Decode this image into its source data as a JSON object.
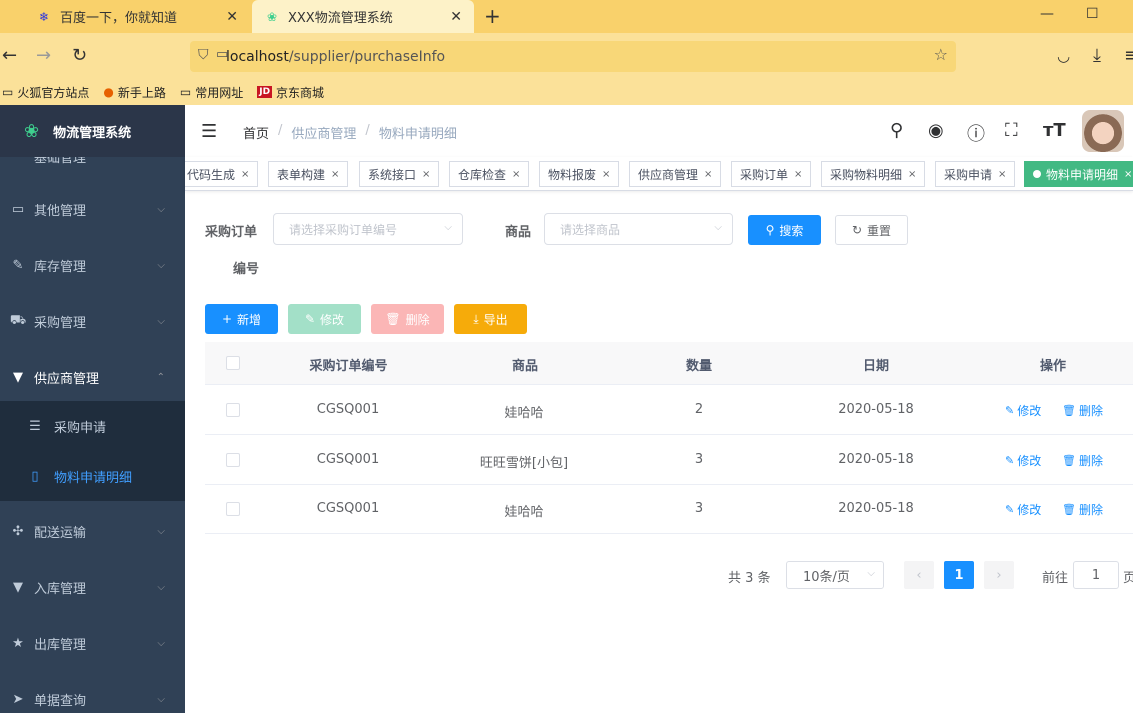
{
  "browser": {
    "tabs": [
      {
        "title": "百度一下，你就知道",
        "icon": "baidu-paw-icon"
      },
      {
        "title": "XXX物流管理系统",
        "icon": "lotus-icon"
      }
    ],
    "url_host": "localhost",
    "url_path": "/supplier/purchaseInfo",
    "bookmarks": [
      "火狐官方站点",
      "新手上路",
      "常用网址",
      "京东商城"
    ],
    "jd_badge": "JD"
  },
  "sidebar": {
    "title": "物流管理系统",
    "partial_item": "基础管理",
    "items": [
      {
        "label": "其他管理",
        "icon": "briefcase-icon"
      },
      {
        "label": "库存管理",
        "icon": "edit-icon"
      },
      {
        "label": "采购管理",
        "icon": "cart-icon"
      },
      {
        "label": "供应商管理",
        "icon": "shirt-icon"
      },
      {
        "label": "配送运输",
        "icon": "compass-icon"
      },
      {
        "label": "入库管理",
        "icon": "shirt-icon"
      },
      {
        "label": "出库管理",
        "icon": "star-icon"
      },
      {
        "label": "单据查询",
        "icon": "send-icon"
      }
    ],
    "submenu": [
      {
        "label": "采购申请",
        "icon": "list-icon"
      },
      {
        "label": "物料申请明细",
        "icon": "book-icon"
      }
    ]
  },
  "header": {
    "breadcrumb": [
      "首页",
      "供应商管理",
      "物料申请明细"
    ],
    "separator": "/"
  },
  "tags": [
    "代码生成",
    "表单构建",
    "系统接口",
    "仓库检查",
    "物料报废",
    "供应商管理",
    "采购订单",
    "采购物料明细",
    "采购申请",
    "物料申请明细"
  ],
  "tag_close": "×",
  "search": {
    "order_label_1": "采购订单",
    "order_label_2": "编号",
    "order_placeholder": "请选择采购订单编号",
    "goods_label": "商品",
    "goods_placeholder": "请选择商品",
    "search_btn": "搜索",
    "reset_btn": "重置"
  },
  "toolbar": {
    "add": "新增",
    "edit": "修改",
    "delete": "删除",
    "export": "导出"
  },
  "table": {
    "columns": [
      "采购订单编号",
      "商品",
      "数量",
      "日期",
      "操作"
    ],
    "rows": [
      {
        "order": "CGSQ001",
        "goods": "娃哈哈",
        "qty": "2",
        "date": "2020-05-18"
      },
      {
        "order": "CGSQ001",
        "goods": "旺旺雪饼[小包]",
        "qty": "3",
        "date": "2020-05-18"
      },
      {
        "order": "CGSQ001",
        "goods": "娃哈哈",
        "qty": "3",
        "date": "2020-05-18"
      }
    ],
    "op_edit": "修改",
    "op_delete": "删除"
  },
  "pagination": {
    "total": "共 3 条",
    "page_size": "10条/页",
    "current": "1",
    "goto_label": "前往",
    "goto_value": "1",
    "page_suffix": "页"
  },
  "colors": {
    "sidebar_bg": "#304156",
    "primary": "#1890ff",
    "tag_active": "#42b983",
    "browser_tab_bg": "#f9d16b"
  }
}
